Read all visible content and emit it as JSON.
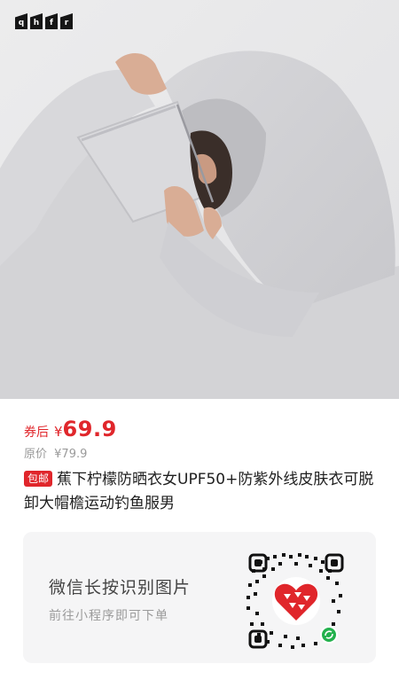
{
  "brand": {
    "logo_letters": [
      "q",
      "h",
      "f",
      "r"
    ]
  },
  "hero": {
    "image_name": "product-photo-hooded-sun-protection-jacket"
  },
  "price": {
    "label": "券后",
    "currency": "¥",
    "value": "69.9",
    "original_label": "原价",
    "original_value": "¥79.9"
  },
  "product": {
    "badge": "包邮",
    "title": "蕉下柠檬防晒衣女UPF50+防紫外线皮肤衣可脱卸大帽檐运动钓鱼服男"
  },
  "qr_card": {
    "main_text": "微信长按识别图片",
    "sub_text": "前往小程序即可下单",
    "qr_icon": "wechat-mini-program-qr-code"
  },
  "colors": {
    "accent": "#e0262b",
    "card_bg": "#f5f5f6",
    "hero_bg": "#e9e9ea"
  }
}
